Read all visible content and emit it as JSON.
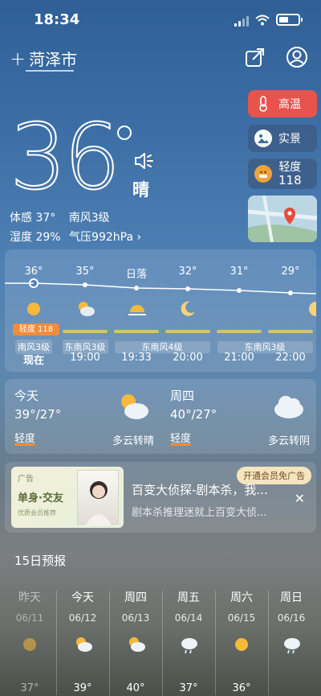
{
  "status_bar": {
    "time": "18:34"
  },
  "header": {
    "city": "菏泽市"
  },
  "badges": {
    "hot": "高温",
    "scene": "实景",
    "aqi_level": "轻度",
    "aqi_value": "118"
  },
  "current": {
    "temperature": "36",
    "condition": "晴",
    "feels_like": "体感 37°",
    "wind": "南风3级",
    "humidity": "湿度 29%",
    "pressure": "气压992hPa ›"
  },
  "hourly": [
    {
      "temp": "36°",
      "wind": "南风3级",
      "time": "现在",
      "icon": "sun-icon",
      "aqi": "轻度 118"
    },
    {
      "temp": "35°",
      "wind": "东南风3级",
      "time": "19:00",
      "icon": "partly-cloudy-icon"
    },
    {
      "temp": "日落",
      "wind": "",
      "time": "19:33",
      "icon": "sunset-icon"
    },
    {
      "temp": "32°",
      "wind": "东南风4级",
      "time": "20:00",
      "icon": "moon-icon"
    },
    {
      "temp": "31°",
      "wind": "",
      "time": "21:00",
      "icon": "moon-icon"
    },
    {
      "temp": "29°",
      "wind": "东南风3级",
      "time": "22:00",
      "icon": "moon-icon"
    }
  ],
  "days": [
    {
      "name": "今天",
      "temp": "39°/27°",
      "aqi": "轻度",
      "condition": "多云转晴",
      "icon": "partly-cloudy-icon"
    },
    {
      "name": "周四",
      "temp": "40°/27°",
      "aqi": "轻度",
      "condition": "多云转阴",
      "icon": "cloud-icon"
    }
  ],
  "ad": {
    "tag": "广告",
    "image_title": "单身·交友",
    "image_sub": "优质会员推荐",
    "vip": "开通会员免广告",
    "title": "百变大侦探-剧本杀，我...",
    "subtitle": "剧本杀推理迷就上百变大侦..."
  },
  "forecast15": {
    "title": "15日预报",
    "days": [
      {
        "name": "昨天",
        "date": "06/11",
        "icon": "sun-icon",
        "temp": "37°"
      },
      {
        "name": "今天",
        "date": "06/12",
        "icon": "partly-cloudy-icon",
        "temp": "39°"
      },
      {
        "name": "周四",
        "date": "06/13",
        "icon": "partly-cloudy-icon",
        "temp": "40°"
      },
      {
        "name": "周五",
        "date": "06/14",
        "icon": "rain-cloud-icon",
        "temp": "37°"
      },
      {
        "name": "周六",
        "date": "06/15",
        "icon": "sun-icon",
        "temp": "36°"
      },
      {
        "name": "周日",
        "date": "06/16",
        "icon": "rain-cloud-icon",
        "temp": ""
      }
    ]
  }
}
